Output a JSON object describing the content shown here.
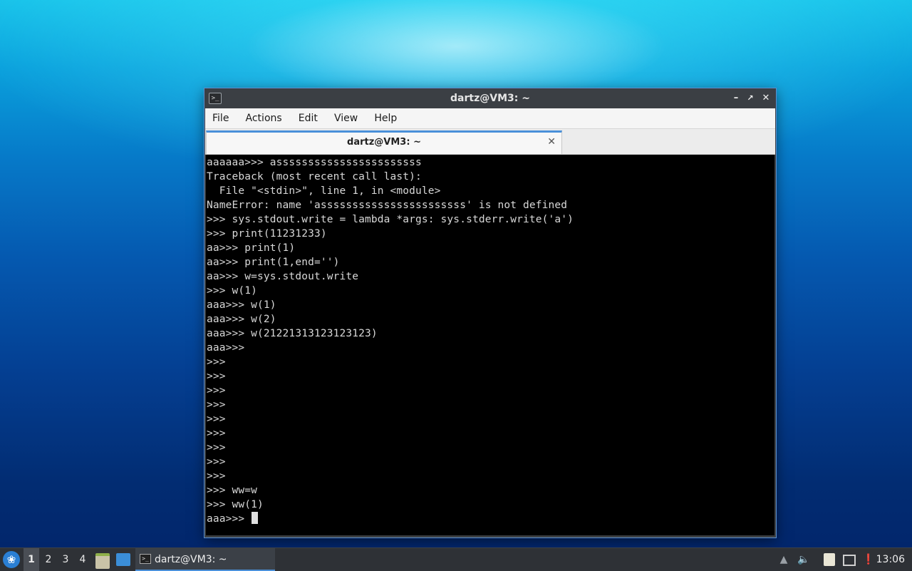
{
  "window": {
    "title": "dartz@VM3: ~",
    "menu": [
      "File",
      "Actions",
      "Edit",
      "View",
      "Help"
    ],
    "tab": {
      "label": "dartz@VM3: ~"
    }
  },
  "terminal": {
    "lines": [
      "aaaaaa>>> asssssssssssssssssssssss",
      "Traceback (most recent call last):",
      "  File \"<stdin>\", line 1, in <module>",
      "NameError: name 'asssssssssssssssssssssss' is not defined",
      ">>> sys.stdout.write = lambda *args: sys.stderr.write('a')",
      ">>> print(11231233)",
      "aa>>> print(1)",
      "aa>>> print(1,end='')",
      "aa>>> w=sys.stdout.write",
      ">>> w(1)",
      "aaa>>> w(1)",
      "aaa>>> w(2)",
      "aaa>>> w(21221313123123123)",
      "aaa>>>",
      ">>>",
      ">>>",
      ">>>",
      ">>>",
      ">>>",
      ">>>",
      ">>>",
      ">>>",
      ">>>",
      ">>> ww=w",
      ">>> ww(1)"
    ],
    "prompt": "aaa>>> "
  },
  "taskbar": {
    "workspaces": [
      "1",
      "2",
      "3",
      "4"
    ],
    "active_workspace": "1",
    "task_label": "dartz@VM3: ~",
    "clock": "13:06"
  },
  "colors": {
    "accent": "#4a90d9",
    "terminal_bg": "#000000",
    "terminal_fg": "#d8d8d8",
    "taskbar_bg": "#2e3136"
  }
}
